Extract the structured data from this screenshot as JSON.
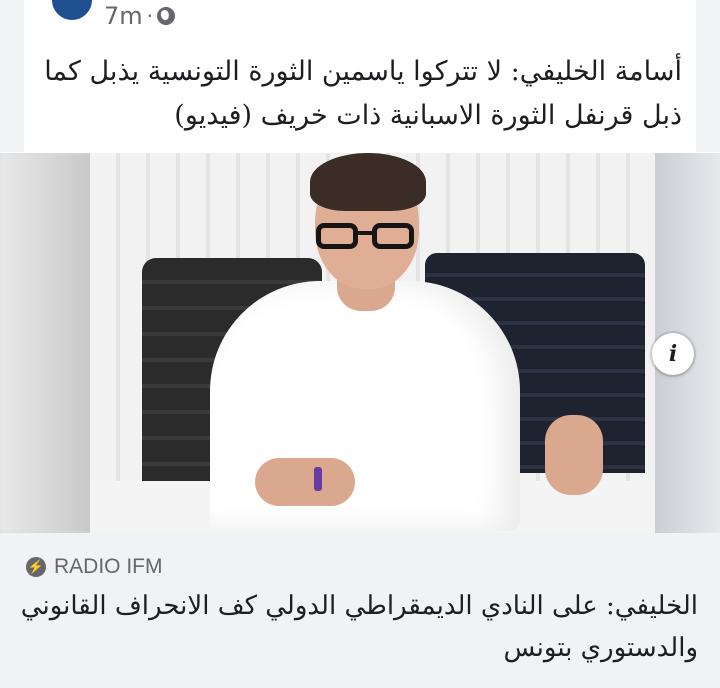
{
  "post": {
    "timestamp": "7m",
    "separator": "·",
    "privacy_icon": "globe-icon",
    "text": "أسامة الخليفي: لا تتركوا ياسمين الثورة التونسية يذبل كما ذبل قرنفل الثورة الاسبانية ذات خريف (فيديو)"
  },
  "image": {
    "info_label": "i"
  },
  "link_preview": {
    "source_icon": "bolt-icon",
    "source": "RADIO IFM",
    "headline": "الخليفي: على النادي الديمقراطي الدولي كف الانحراف القانوني والدستوري بتونس"
  },
  "colors": {
    "caption_bg": "#f0f2f5",
    "meta_text": "#65676b",
    "body_text": "#1c1e21"
  }
}
